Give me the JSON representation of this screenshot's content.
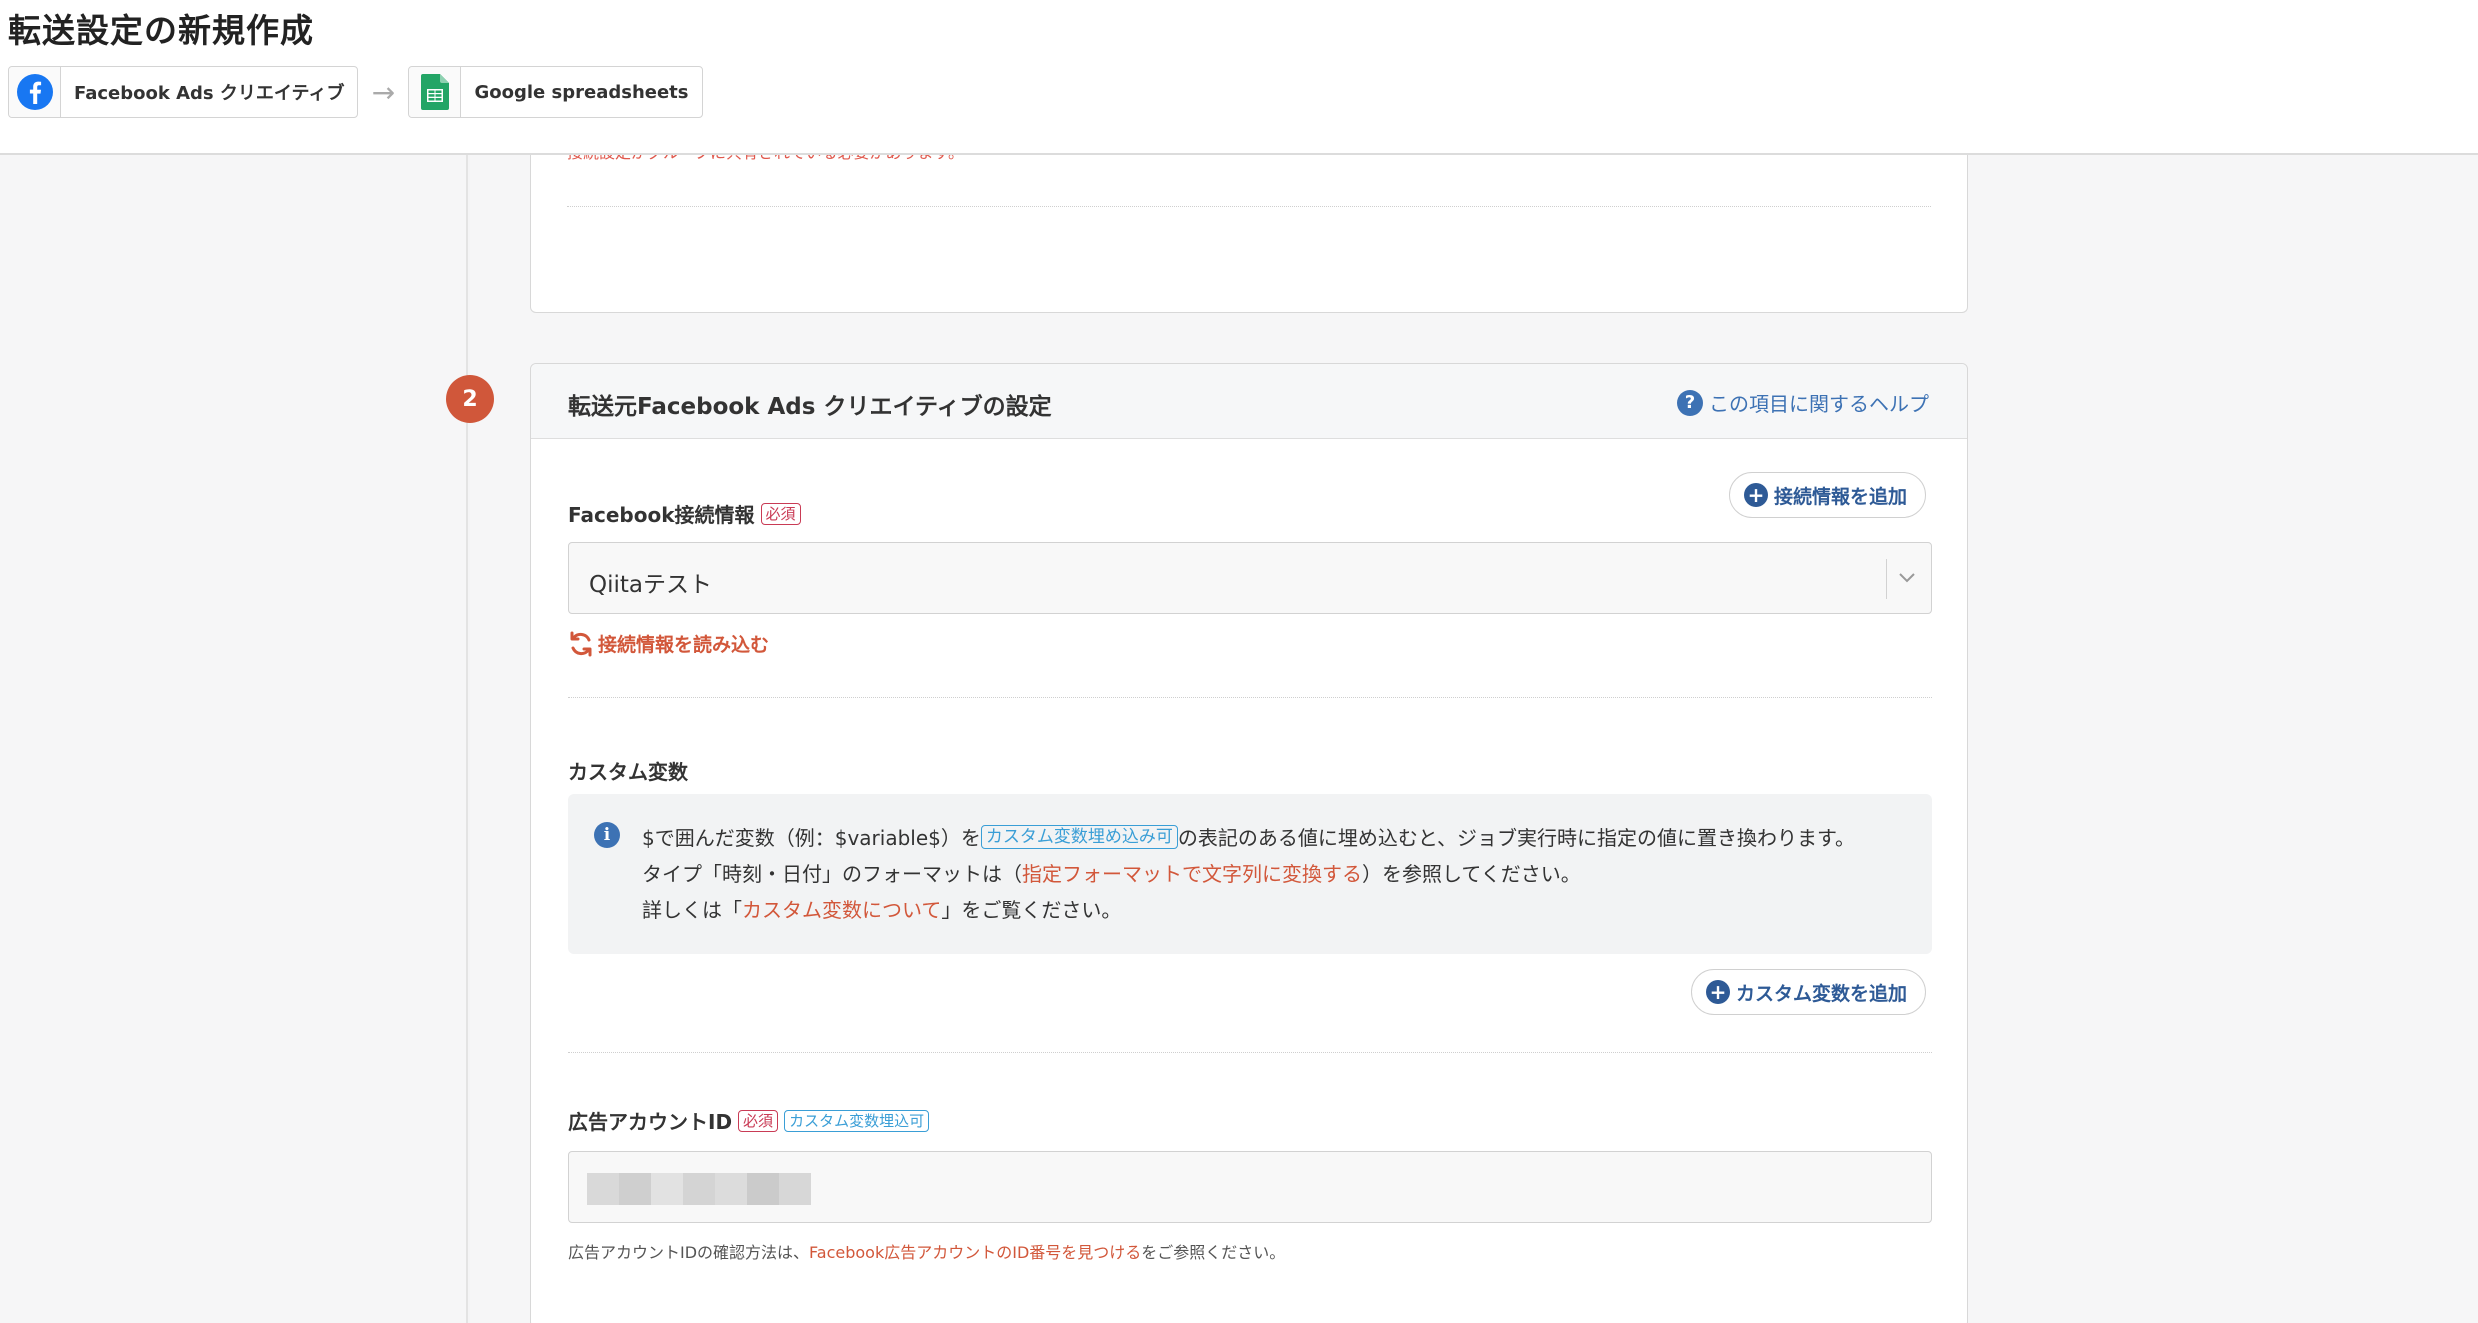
{
  "header": {
    "title": "転送設定の新規作成",
    "source_service": "Facebook Ads クリエイティブ",
    "destination_service": "Google spreadsheets",
    "arrow": "→"
  },
  "previous_section": {
    "note": "接続設定がグループに共有されている必要があります。"
  },
  "step": {
    "number": "2",
    "title": "転送元Facebook Ads クリエイティブの設定",
    "help_link": "この項目に関するヘルプ"
  },
  "connection": {
    "label": "Facebook接続情報",
    "required_tag": "必須",
    "add_button": "接続情報を追加",
    "selected_value": "Qiitaテスト",
    "reload_link": "接続情報を読み込む"
  },
  "custom_vars": {
    "label": "カスタム変数",
    "info_line1_pre": "$で囲んだ変数（例：$variable$）を",
    "info_line1_tag": "カスタム変数埋め込み可",
    "info_line1_post": "の表記のある値に埋め込むと、ジョブ実行時に指定の値に置き換わります。",
    "info_line2_pre": "タイプ「時刻・日付」のフォーマットは（",
    "info_line2_link": "指定フォーマットで文字列に変換する",
    "info_line2_post": "）を参照してください。",
    "info_line3_pre": "詳しくは「",
    "info_line3_link": "カスタム変数について",
    "info_line3_post": "」をご覧ください。",
    "add_button": "カスタム変数を追加"
  },
  "ad_account": {
    "label": "広告アカウントID",
    "required_tag": "必須",
    "custom_var_tag": "カスタム変数埋込可",
    "help_pre": "広告アカウントIDの確認方法は、",
    "help_link": "Facebook広告アカウントのID番号を見つける",
    "help_post": "をご参照ください。"
  },
  "colors": {
    "accent": "#d0573a",
    "link_blue": "#3d72b4",
    "required_red": "#c93b55",
    "tag_blue": "#3a9ed6"
  }
}
